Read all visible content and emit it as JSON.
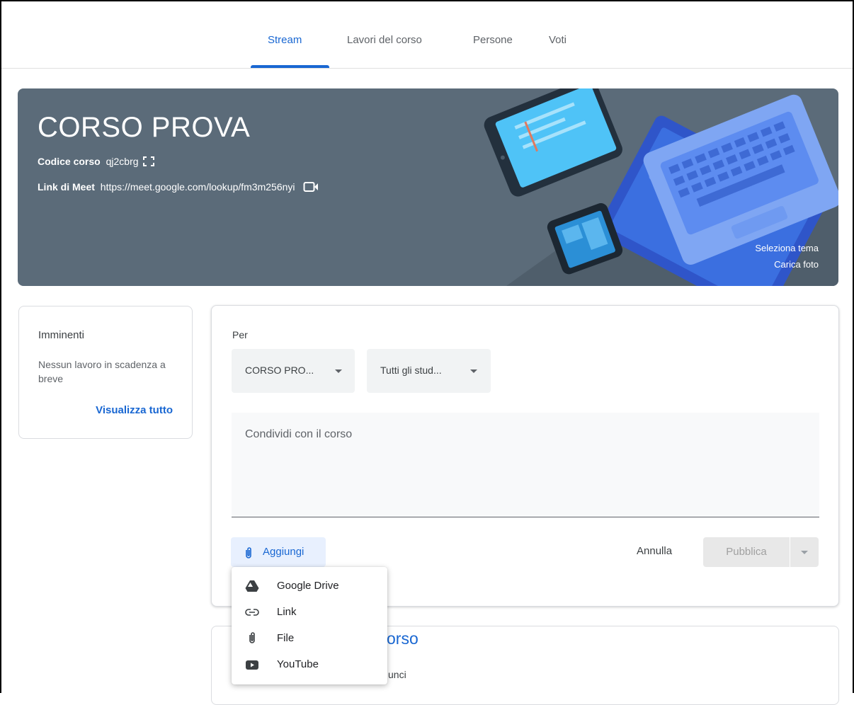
{
  "tabs": [
    {
      "label": "Stream",
      "active": true
    },
    {
      "label": "Lavori del corso",
      "active": false
    },
    {
      "label": "Persone",
      "active": false
    },
    {
      "label": "Voti",
      "active": false
    }
  ],
  "banner": {
    "title": "CORSO PROVA",
    "code_label": "Codice corso",
    "code_value": "qj2cbrg",
    "meet_label": "Link di Meet",
    "meet_url": "https://meet.google.com/lookup/fm3m256nyi",
    "select_theme": "Seleziona tema",
    "upload_photo": "Carica foto",
    "background_color": "#5b6b79"
  },
  "upcoming": {
    "heading": "Imminenti",
    "text": "Nessun lavoro in scadenza a breve",
    "view_all": "Visualizza tutto"
  },
  "post": {
    "for_label": "Per",
    "course_select": "CORSO PRO...",
    "students_select": "Tutti gli stud...",
    "share_placeholder": "Condividi con il corso",
    "add_label": "Aggiungi",
    "cancel_label": "Annulla",
    "publish_label": "Pubblica"
  },
  "add_menu": {
    "items": [
      {
        "label": "Google Drive",
        "icon": "google-drive-icon"
      },
      {
        "label": "Link",
        "icon": "link-icon"
      },
      {
        "label": "File",
        "icon": "paperclip-icon"
      },
      {
        "label": "YouTube",
        "icon": "youtube-icon"
      }
    ]
  },
  "card2": {
    "title_fragment": "l corso",
    "sub_fragment": "unci"
  },
  "colors": {
    "accent": "#1967d2",
    "tab_active": "#1967d2",
    "add_button_bg": "#e8f0fe"
  }
}
